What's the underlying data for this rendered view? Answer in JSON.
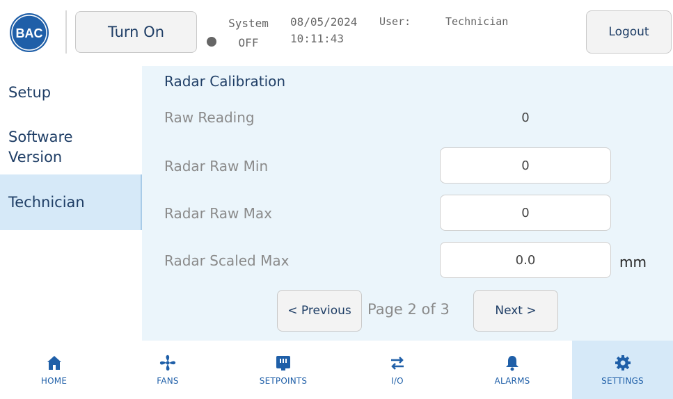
{
  "header": {
    "logo_text": "BAC",
    "turn_on_label": "Turn On",
    "system_label": "System",
    "system_state": "OFF",
    "date": "08/05/2024",
    "time": "10:11:43",
    "user_label": "User:",
    "user_value": "Technician",
    "logout_label": "Logout"
  },
  "sidebar": {
    "items": [
      {
        "label": "Setup"
      },
      {
        "label": "Software Version"
      },
      {
        "label": "Technician"
      }
    ],
    "active_index": 2
  },
  "main": {
    "title": "Radar Calibration",
    "rows": [
      {
        "label": "Raw Reading",
        "value": "0"
      },
      {
        "label": "Radar Raw Min",
        "value": "0"
      },
      {
        "label": "Radar Raw Max",
        "value": "0"
      },
      {
        "label": "Radar Scaled Max",
        "value": "0.0",
        "unit": "mm"
      }
    ],
    "pager": {
      "prev_label": "< Previous",
      "page_text": "Page 2 of 3",
      "next_label": "Next >"
    }
  },
  "nav": {
    "items": [
      {
        "label": "HOME",
        "icon": "home-icon"
      },
      {
        "label": "FANS",
        "icon": "fan-icon"
      },
      {
        "label": "SETPOINTS",
        "icon": "setpoints-icon"
      },
      {
        "label": "I/O",
        "icon": "io-arrows-icon"
      },
      {
        "label": "ALARMS",
        "icon": "bell-icon"
      },
      {
        "label": "SETTINGS",
        "icon": "gear-icon"
      }
    ],
    "active_index": 5
  },
  "colors": {
    "brand_blue": "#1f5fa8",
    "text_dark_blue": "#1f3e66",
    "panel_background": "#ebf5fb",
    "active_highlight": "#d6e9f8",
    "status_off": "#666666"
  }
}
